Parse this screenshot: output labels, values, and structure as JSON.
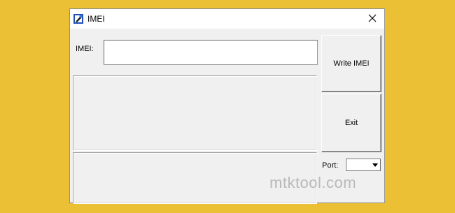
{
  "window": {
    "title": "IMEI",
    "close_icon": "close-icon",
    "app_icon": "tool-app-icon"
  },
  "form": {
    "imei_label": "IMEI:",
    "imei_value": "",
    "port_label": "Port:",
    "port_value": ""
  },
  "buttons": {
    "write_imei": "Write IMEI",
    "exit": "Exit"
  },
  "watermark": "mtktool.com",
  "colors": {
    "background": "#ecc034",
    "window": "#f0f0f0"
  }
}
